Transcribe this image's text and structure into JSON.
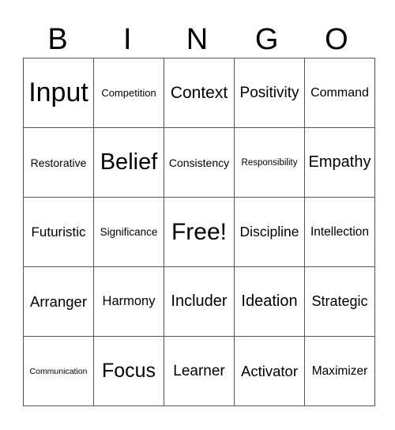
{
  "header": [
    "B",
    "I",
    "N",
    "G",
    "O"
  ],
  "cells": [
    [
      "Input",
      "Competition",
      "Context",
      "Positivity",
      "Command"
    ],
    [
      "Restorative",
      "Belief",
      "Consistency",
      "Responsibility",
      "Empathy"
    ],
    [
      "Futuristic",
      "Significance",
      "Free!",
      "Discipline",
      "Intellection"
    ],
    [
      "Arranger",
      "Harmony",
      "Includer",
      "Ideation",
      "Strategic"
    ],
    [
      "Communication",
      "Focus",
      "Learner",
      "Activator",
      "Maximizer"
    ]
  ]
}
